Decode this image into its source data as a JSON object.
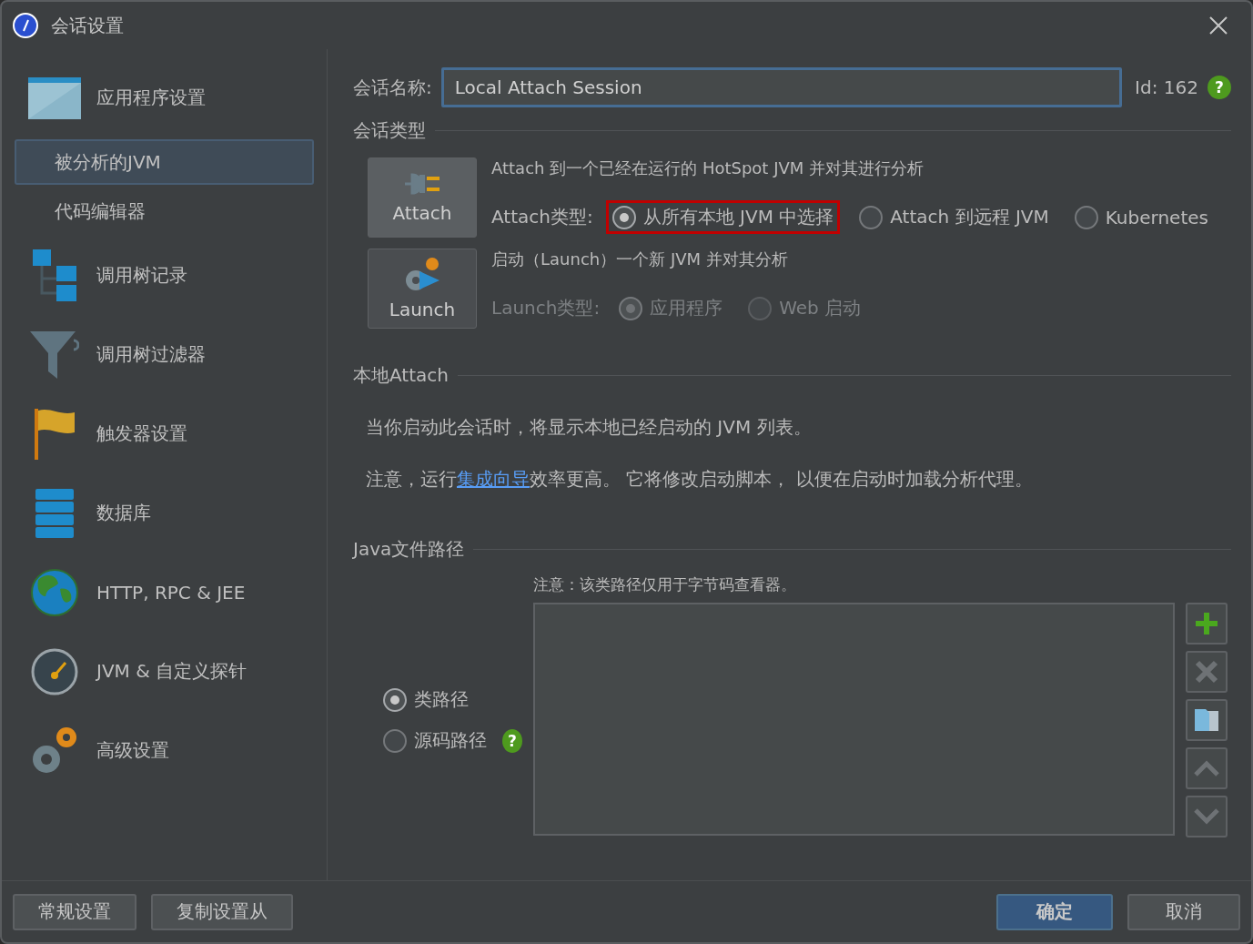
{
  "window": {
    "title": "会话设置"
  },
  "sidebar": {
    "items": [
      {
        "kind": "group",
        "label": "应用程序设置",
        "selected": false
      },
      {
        "kind": "sub",
        "label": "被分析的JVM",
        "selected": true
      },
      {
        "kind": "sub",
        "label": "代码编辑器",
        "selected": false
      },
      {
        "kind": "group",
        "label": "调用树记录",
        "selected": false
      },
      {
        "kind": "group",
        "label": "调用树过滤器",
        "selected": false
      },
      {
        "kind": "group",
        "label": "触发器设置",
        "selected": false
      },
      {
        "kind": "group",
        "label": "数据库",
        "selected": false
      },
      {
        "kind": "group",
        "label": "HTTP, RPC & JEE",
        "selected": false
      },
      {
        "kind": "group",
        "label": "JVM & 自定义探针",
        "selected": false
      },
      {
        "kind": "group",
        "label": "高级设置",
        "selected": false
      }
    ]
  },
  "session_name": {
    "label": "会话名称:",
    "value": "Local Attach Session",
    "id_label": "Id:",
    "id_value": "162",
    "help": "?"
  },
  "session_type": {
    "title": "会话类型",
    "types": [
      {
        "label": "Attach",
        "selected": true,
        "disabled": false,
        "description": "Attach 到一个已经在运行的 HotSpot JVM 并对其进行分析",
        "type_label": "Attach类型:",
        "options": [
          {
            "label": "从所有本地 JVM 中选择",
            "selected": true,
            "highlighted": true
          },
          {
            "label": "Attach 到远程 JVM",
            "selected": false,
            "highlighted": false
          },
          {
            "label": "Kubernetes",
            "selected": false,
            "highlighted": false
          }
        ]
      },
      {
        "label": "Launch",
        "selected": false,
        "disabled": true,
        "description": "启动（Launch）一个新 JVM 并对其分析",
        "type_label": "Launch类型:",
        "options": [
          {
            "label": "应用程序",
            "selected": true,
            "highlighted": false
          },
          {
            "label": "Web 启动",
            "selected": false,
            "highlighted": false
          }
        ]
      }
    ]
  },
  "local_attach": {
    "title": "本地Attach",
    "line_1": "当你启动此会话时，将显示本地已经启动的 JVM 列表。",
    "line_2_before": "注意，运行",
    "line_2_link": "集成向导",
    "line_2_after": "效率更高。 它将修改启动脚本， 以便在启动时加载分析代理。"
  },
  "java_path": {
    "title": "Java文件路径",
    "note": "注意：该类路径仅用于字节码查看器。",
    "options": [
      {
        "label": "类路径",
        "selected": true
      },
      {
        "label": "源码路径",
        "selected": false,
        "help": "?"
      }
    ]
  },
  "footer": {
    "left_buttons": [
      "常规设置",
      "复制设置从"
    ],
    "ok": "确定",
    "cancel": "取消"
  }
}
